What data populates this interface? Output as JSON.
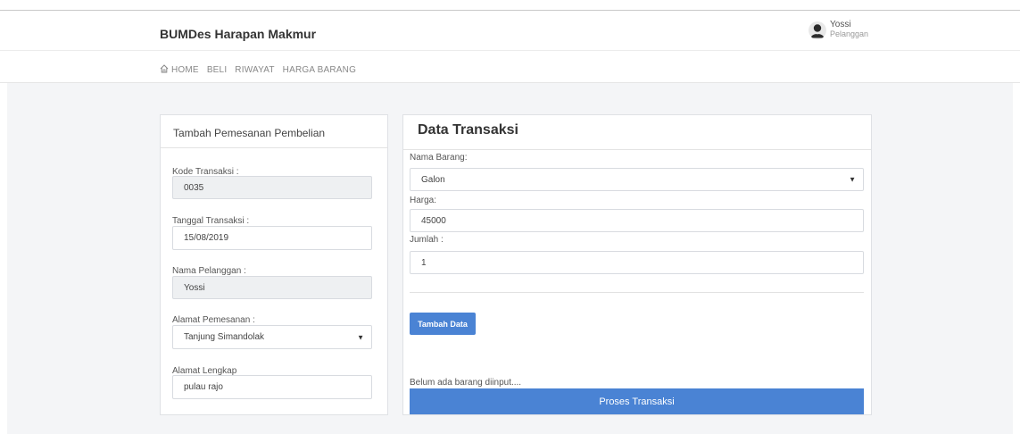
{
  "header": {
    "brand": "BUMDes Harapan Makmur",
    "user_name": "Yossi",
    "user_role": "Pelanggan"
  },
  "nav": {
    "items": [
      "HOME",
      "BELI",
      "RIWAYAT",
      "HARGA BARANG"
    ]
  },
  "left_card": {
    "title": "Tambah Pemesanan Pembelian",
    "kode_label": "Kode Transaksi :",
    "kode_value": "0035",
    "tanggal_label": "Tanggal Transaksi :",
    "tanggal_value": "15/08/2019",
    "nama_label": "Nama Pelanggan :",
    "nama_value": "Yossi",
    "alamat_label": "Alamat Pemesanan :",
    "alamat_value": "Tanjung Simandolak",
    "alamat_lengkap_label": "Alamat Lengkap",
    "alamat_lengkap_value": "pulau rajo"
  },
  "right_card": {
    "title": "Data Transaksi",
    "barang_label": "Nama Barang:",
    "barang_value": "Galon",
    "harga_label": "Harga:",
    "harga_value": "45000",
    "jumlah_label": "Jumlah :",
    "jumlah_value": "1",
    "add_button": "Tambah Data",
    "empty_message": "Belum ada barang diinput....",
    "process_button": "Proses Transaksi"
  },
  "colors": {
    "primary": "#4a83d4",
    "background": "#f4f5f7"
  }
}
